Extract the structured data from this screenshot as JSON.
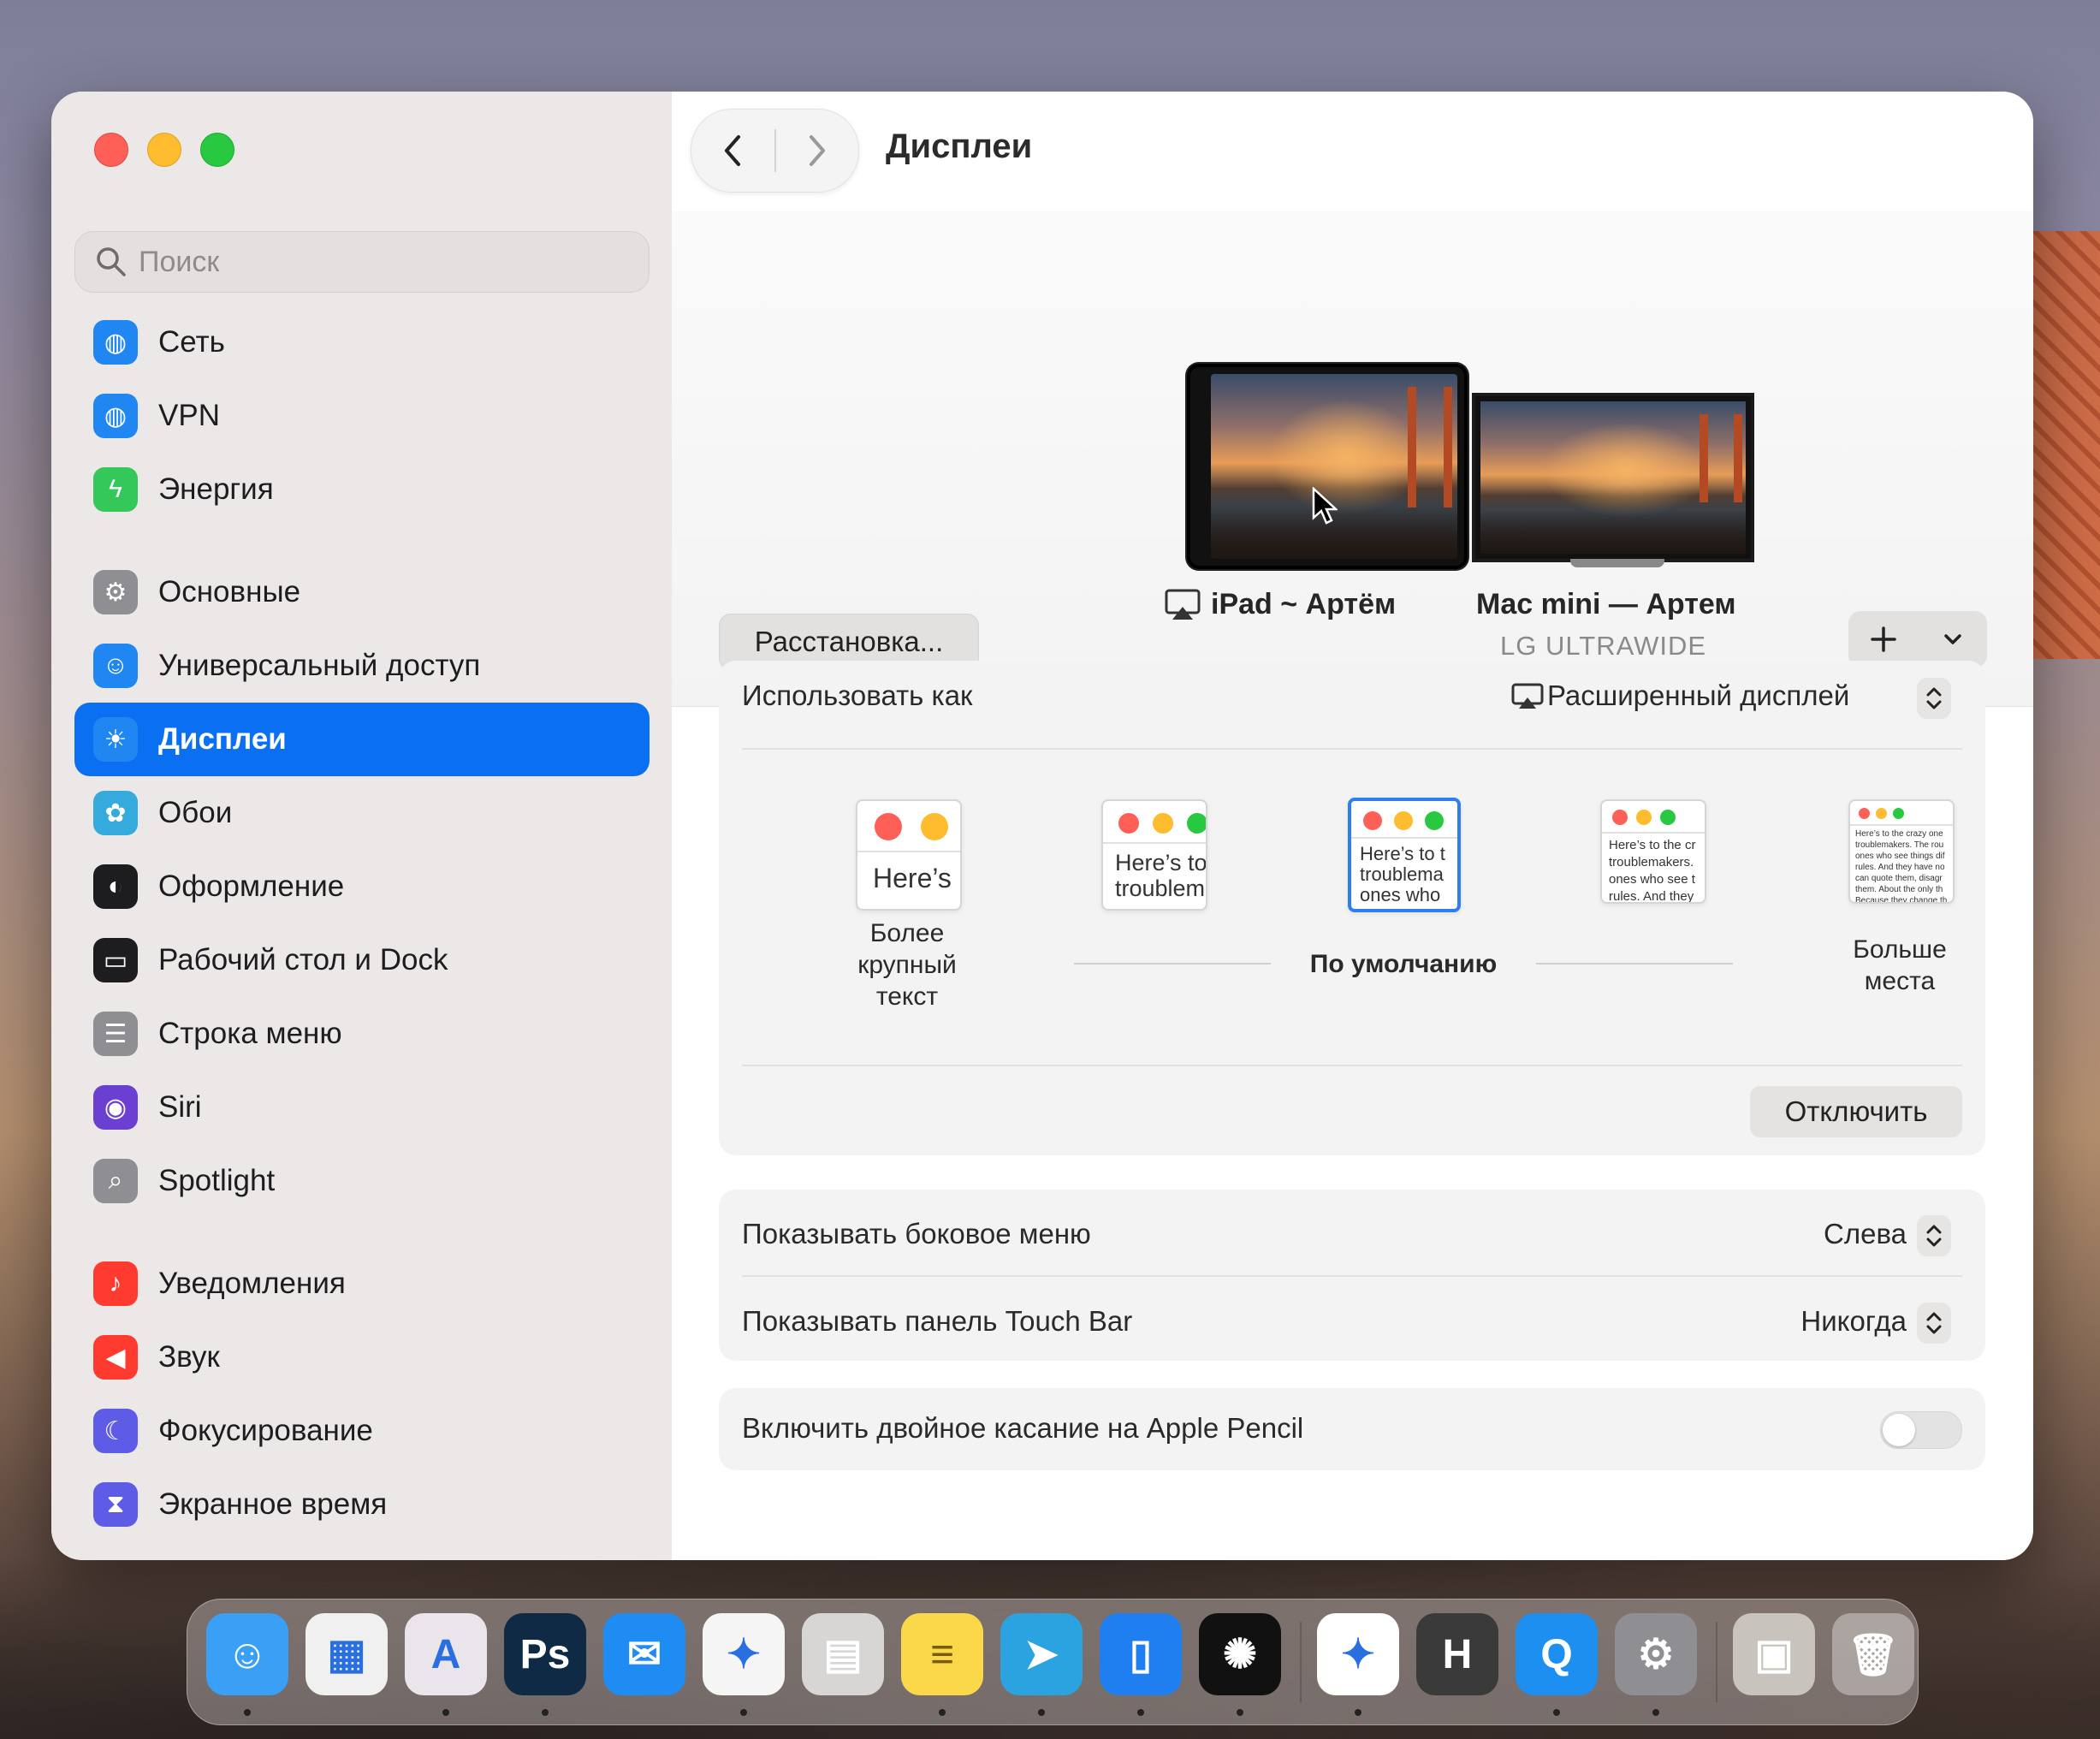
{
  "window": {
    "title": "Дисплеи",
    "search_placeholder": "Поиск"
  },
  "sidebar": {
    "group1": [
      {
        "label": "Сеть",
        "icon": "globe-icon",
        "color": "#1f86f2"
      },
      {
        "label": "VPN",
        "icon": "vpn-globe-icon",
        "color": "#1f86f2"
      },
      {
        "label": "Энергия",
        "icon": "battery-bolt-icon",
        "color": "#34c759"
      }
    ],
    "group2": [
      {
        "label": "Основные",
        "icon": "gear-icon",
        "color": "#8e8e93"
      },
      {
        "label": "Универсальный доступ",
        "icon": "accessibility-icon",
        "color": "#1f86f2"
      },
      {
        "label": "Дисплеи",
        "icon": "sun-icon",
        "color": "#1f86f2",
        "active": true
      },
      {
        "label": "Обои",
        "icon": "flower-icon",
        "color": "#35aadc"
      },
      {
        "label": "Оформление",
        "icon": "appearance-icon",
        "color": "#1d1d1f"
      },
      {
        "label": "Рабочий стол и Dock",
        "icon": "dock-icon",
        "color": "#1d1d1f"
      },
      {
        "label": "Строка меню",
        "icon": "menubar-icon",
        "color": "#8e8e93"
      },
      {
        "label": "Siri",
        "icon": "siri-icon",
        "color": "#6b3fd1"
      },
      {
        "label": "Spotlight",
        "icon": "magnifier-icon",
        "color": "#8e8e93"
      }
    ],
    "group3": [
      {
        "label": "Уведомления",
        "icon": "bell-icon",
        "color": "#ff3b30"
      },
      {
        "label": "Звук",
        "icon": "speaker-icon",
        "color": "#ff3b30"
      },
      {
        "label": "Фокусирование",
        "icon": "moon-icon",
        "color": "#5e5ce6"
      },
      {
        "label": "Экранное время",
        "icon": "hourglass-icon",
        "color": "#5e5ce6"
      }
    ]
  },
  "displays": {
    "arrange_label": "Расстановка...",
    "ipad_name": "iPad ~ Артём",
    "mac_name": "Mac mini — Артем",
    "mac_sub": "LG ULTRAWIDE",
    "add_symbol": "+",
    "chevron_symbol": "⌄"
  },
  "use_as": {
    "label": "Использовать как",
    "value": "Расширенный дисплей"
  },
  "scaling": {
    "thumbs": [
      {
        "text": "Here’s"
      },
      {
        "text": "Here’s to\ntroublem"
      },
      {
        "text": "Here’s to t\ntroublema\nones who"
      },
      {
        "text": "Here’s to the cr\ntroublemakers.\nones who see t\nrules. And they"
      },
      {
        "text": "Here’s to the crazy one\ntroublemakers. The rou\nones who see things dif\nrules. And they have no\ncan quote them, disagr\nthem. About the only th\nBecause they change th"
      }
    ],
    "label_larger": "Более крупный текст",
    "label_default": "По умолчанию",
    "label_more": "Больше места",
    "disconnect": "Отключить"
  },
  "settings": {
    "sidebar_label": "Показывать боковое меню",
    "sidebar_value": "Слева",
    "touchbar_label": "Показывать панель Touch Bar",
    "touchbar_value": "Никогда",
    "pencil_label": "Включить двойное касание на Apple Pencil",
    "pencil_on": false
  },
  "dock": {
    "apps": [
      {
        "name": "finder-icon",
        "glyph": "☺",
        "bg": "#3aa0f5",
        "running": true
      },
      {
        "name": "launchpad-icon",
        "glyph": "▦",
        "bg": "#f0f0f0",
        "running": false
      },
      {
        "name": "creative-cloud-icon",
        "glyph": "A",
        "bg": "#e9e5ea",
        "running": true
      },
      {
        "name": "photoshop-icon",
        "glyph": "Ps",
        "bg": "#0f2a44",
        "running": true
      },
      {
        "name": "mail-icon",
        "glyph": "✉",
        "bg": "#1f8cf3",
        "running": false
      },
      {
        "name": "safari-icon",
        "glyph": "✦",
        "bg": "#f5f5f5",
        "running": true
      },
      {
        "name": "calculator-icon",
        "glyph": "▤",
        "bg": "#d8d6d4",
        "running": false
      },
      {
        "name": "notes-icon",
        "glyph": "≡",
        "bg": "#fbd84a",
        "running": true
      },
      {
        "name": "telegram-icon",
        "glyph": "➤",
        "bg": "#2ba3e0",
        "running": true
      },
      {
        "name": "sidecar-icon",
        "glyph": "▯",
        "bg": "#1f7ef0",
        "running": true
      },
      {
        "name": "chatgpt-icon",
        "glyph": "✺",
        "bg": "#111111",
        "running": true
      },
      {
        "name": "gemini-icon",
        "glyph": "✦",
        "bg": "#ffffff",
        "running": true
      },
      {
        "name": "hype-icon",
        "glyph": "H",
        "bg": "#3a3a3a",
        "running": false
      },
      {
        "name": "quicktime-icon",
        "glyph": "Q",
        "bg": "#1d8ff0",
        "running": true
      },
      {
        "name": "system-settings-icon",
        "glyph": "⚙",
        "bg": "#8e8e93",
        "running": true
      },
      {
        "name": "preview-icon",
        "glyph": "▣",
        "bg": "#c9c3be",
        "running": false
      },
      {
        "name": "trash-icon",
        "glyph": "🗑",
        "bg": "rgba(255,255,255,0.35)",
        "running": false
      }
    ]
  }
}
